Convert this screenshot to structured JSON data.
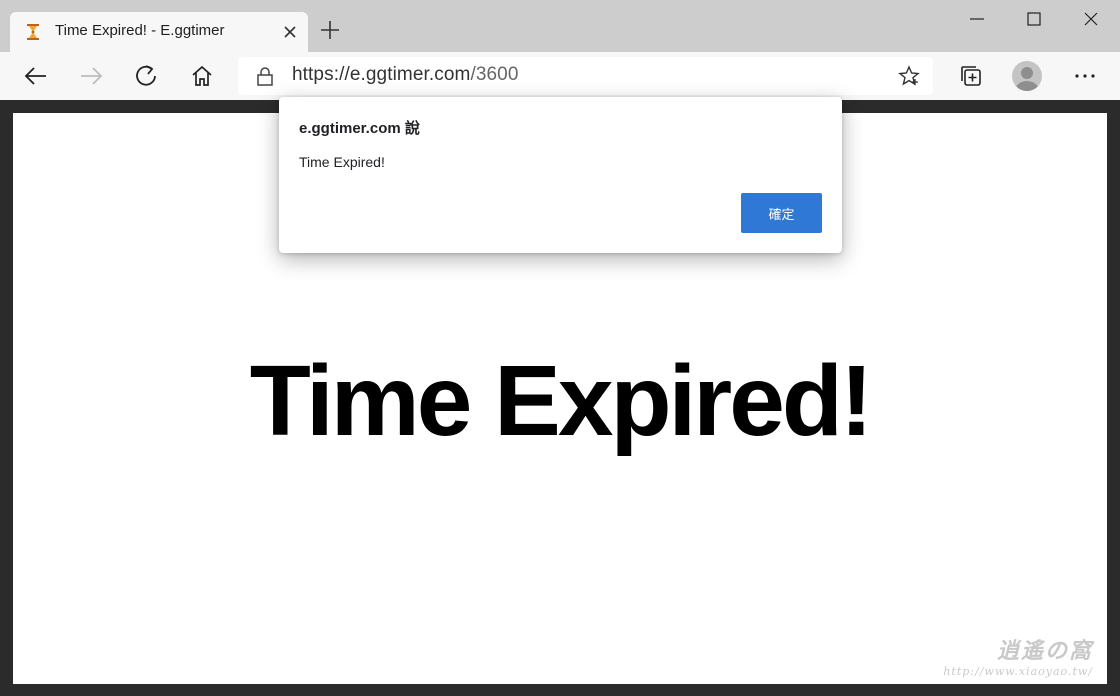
{
  "browser": {
    "tab": {
      "title": "Time Expired! - E.ggtimer"
    },
    "address_bar": {
      "scheme_host": "https://e.ggtimer.com",
      "path": "/3600"
    }
  },
  "page": {
    "heading": "Time Expired!"
  },
  "dialog": {
    "title": "e.ggtimer.com 說",
    "message": "Time Expired!",
    "ok_label": "確定"
  },
  "watermark": {
    "brand": "逍遙の窩",
    "url": "http://www.xiaoyao.tw/"
  },
  "colors": {
    "accent": "#2f78d5",
    "tabstrip": "#cdcdcd",
    "toolbar": "#f7f7f7"
  }
}
